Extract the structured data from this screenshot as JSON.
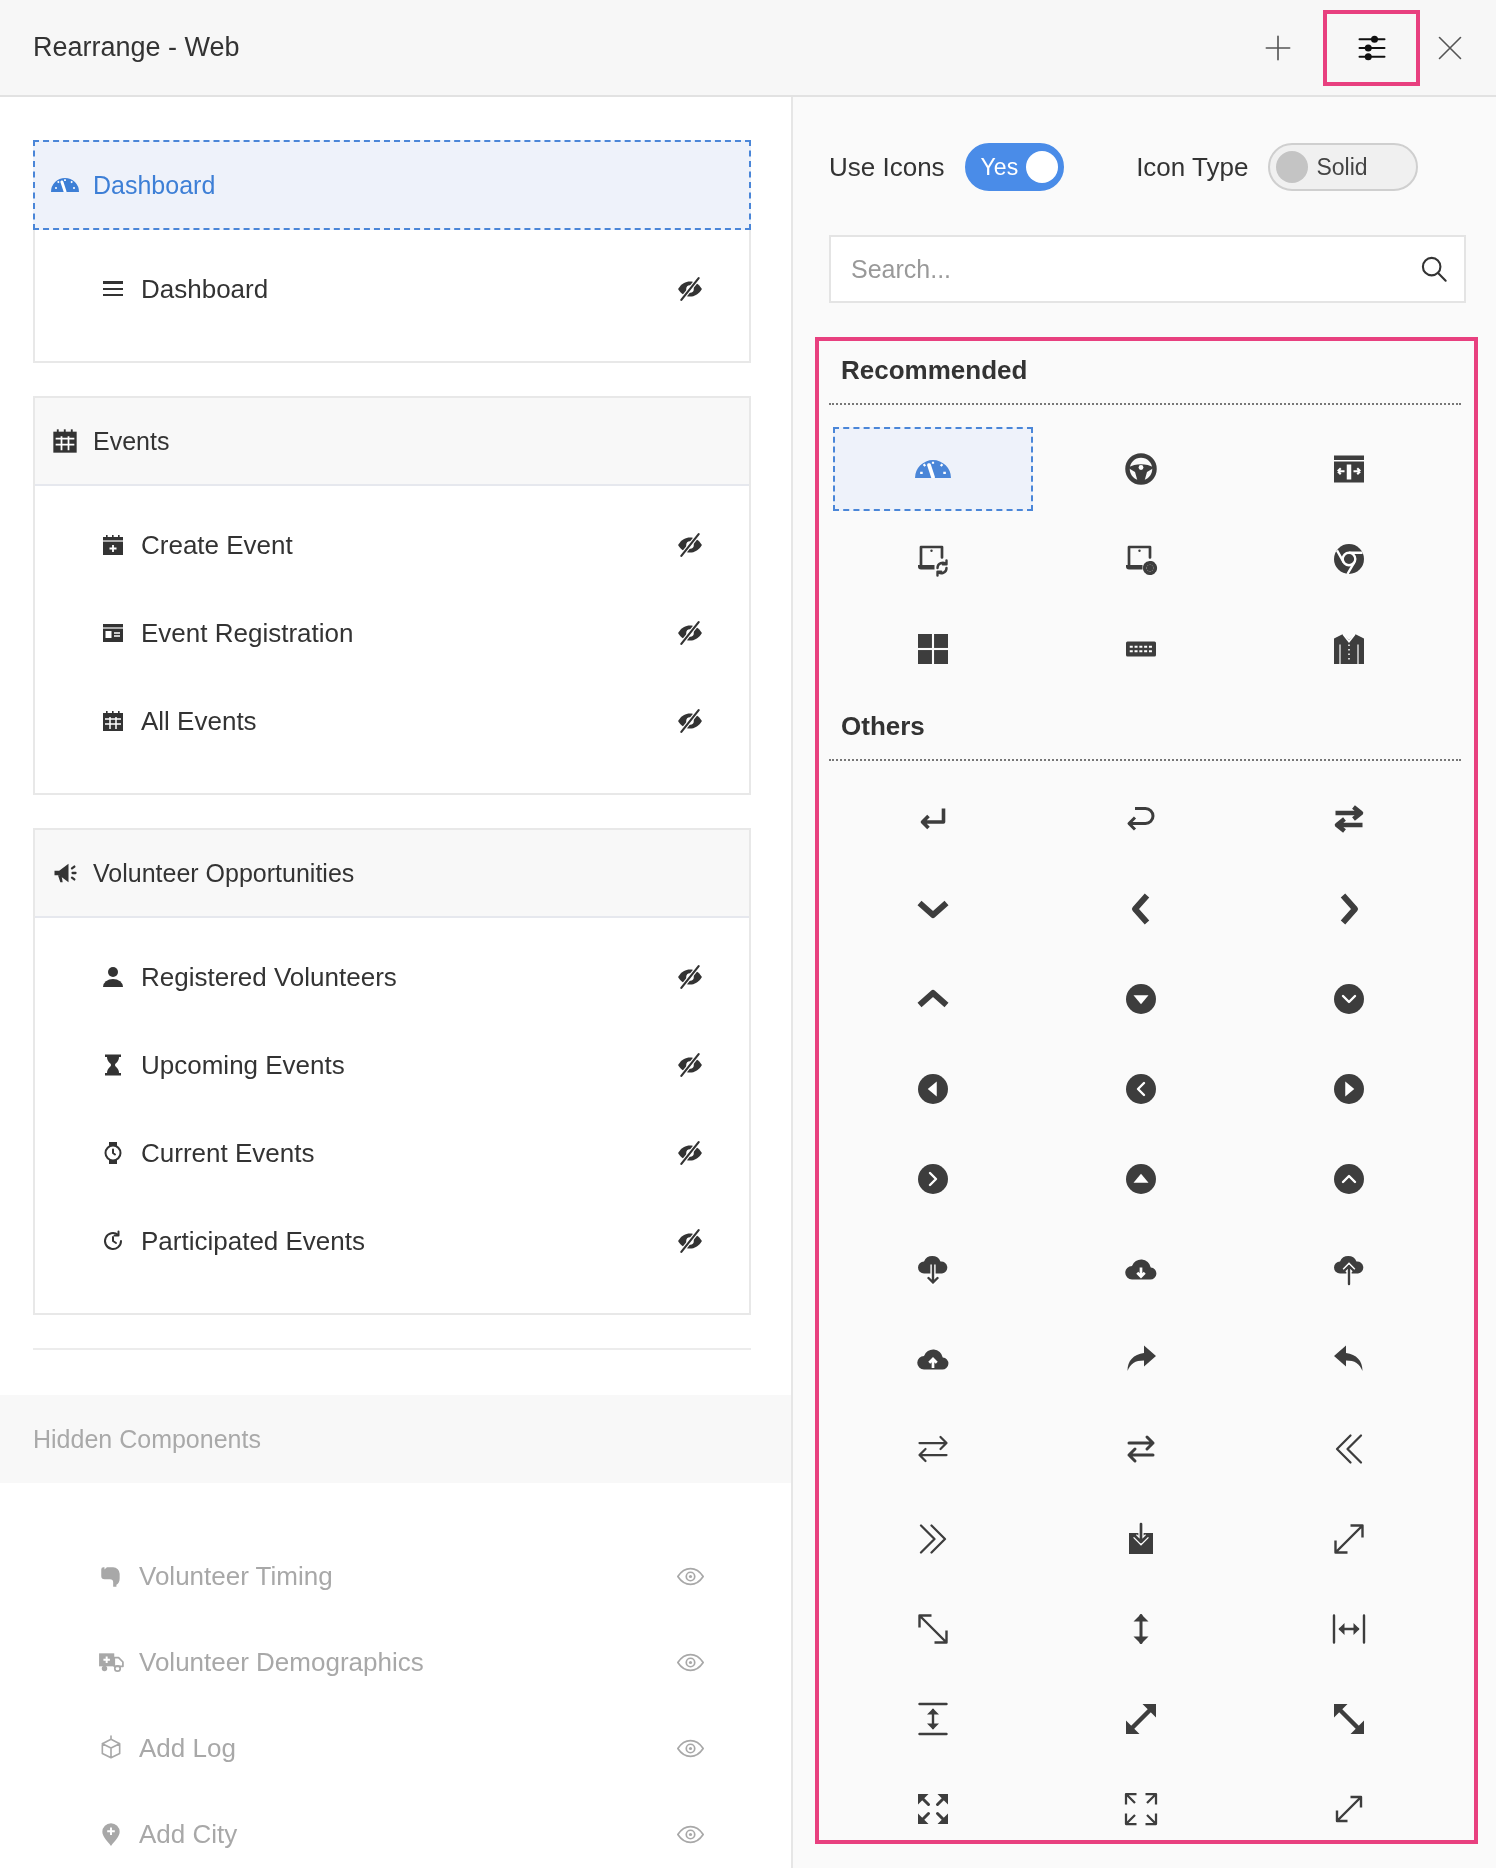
{
  "window": {
    "title": "Rearrange - Web"
  },
  "header_actions": [
    {
      "kind": "add",
      "selected": false
    },
    {
      "kind": "settings",
      "selected": true
    },
    {
      "kind": "close",
      "selected": false
    }
  ],
  "groups": [
    {
      "label": "Dashboard",
      "selected": true,
      "items": [
        {
          "label": "Dashboard",
          "hidden": false
        }
      ]
    },
    {
      "label": "Events",
      "selected": false,
      "items": [
        {
          "label": "Create Event",
          "hidden": false
        },
        {
          "label": "Event Registration",
          "hidden": false
        },
        {
          "label": "All Events",
          "hidden": false
        }
      ]
    },
    {
      "label": "Volunteer Opportunities",
      "selected": false,
      "items": [
        {
          "label": "Registered Volunteers",
          "hidden": false
        },
        {
          "label": "Upcoming Events",
          "hidden": false
        },
        {
          "label": "Current Events",
          "hidden": false
        },
        {
          "label": "Participated Events",
          "hidden": false
        }
      ]
    }
  ],
  "hidden_components": {
    "title": "Hidden Components",
    "items": [
      {
        "label": "Volunteer Timing",
        "hidden": true
      },
      {
        "label": "Volunteer Demographics",
        "hidden": true
      },
      {
        "label": "Add Log",
        "hidden": true
      },
      {
        "label": "Add City",
        "hidden": true
      }
    ]
  },
  "settings": [
    {
      "label": "Use Icons",
      "value": "Yes",
      "on": true
    },
    {
      "label": "Icon Type",
      "value": "Solid",
      "on": false
    }
  ],
  "search": {
    "placeholder": "Search..."
  },
  "icon_sections": [
    {
      "title": "Recommended",
      "icons": [
        {
          "selected": true
        },
        {
          "selected": false
        },
        {
          "selected": false
        },
        {
          "selected": false
        },
        {
          "selected": false
        },
        {
          "selected": false
        },
        {
          "selected": false
        },
        {
          "selected": false
        },
        {
          "selected": false
        }
      ]
    },
    {
      "title": "Others",
      "icons": [
        {
          "selected": false
        },
        {
          "selected": false
        },
        {
          "selected": false
        },
        {
          "selected": false
        },
        {
          "selected": false
        },
        {
          "selected": false
        },
        {
          "selected": false
        },
        {
          "selected": false
        },
        {
          "selected": false
        },
        {
          "selected": false
        },
        {
          "selected": false
        },
        {
          "selected": false
        },
        {
          "selected": false
        },
        {
          "selected": false
        },
        {
          "selected": false
        },
        {
          "selected": false
        },
        {
          "selected": false
        },
        {
          "selected": false
        },
        {
          "selected": false
        },
        {
          "selected": false
        },
        {
          "selected": false
        },
        {
          "selected": false
        },
        {
          "selected": false
        },
        {
          "selected": false
        },
        {
          "selected": false
        },
        {
          "selected": false
        },
        {
          "selected": false
        },
        {
          "selected": false
        },
        {
          "selected": false
        },
        {
          "selected": false
        },
        {
          "selected": false
        },
        {
          "selected": false
        },
        {
          "selected": false
        },
        {
          "selected": false
        },
        {
          "selected": false
        },
        {
          "selected": false
        }
      ]
    }
  ]
}
